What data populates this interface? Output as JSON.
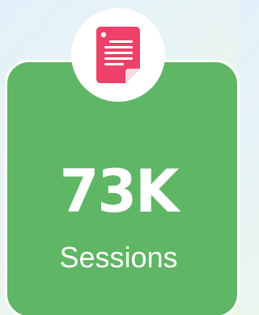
{
  "stat": {
    "value": "73K",
    "label": "Sessions",
    "icon": "document-icon"
  },
  "colors": {
    "card_background": "#5fb664",
    "icon_primary": "#ee4068",
    "icon_fold": "#fbd9df"
  }
}
